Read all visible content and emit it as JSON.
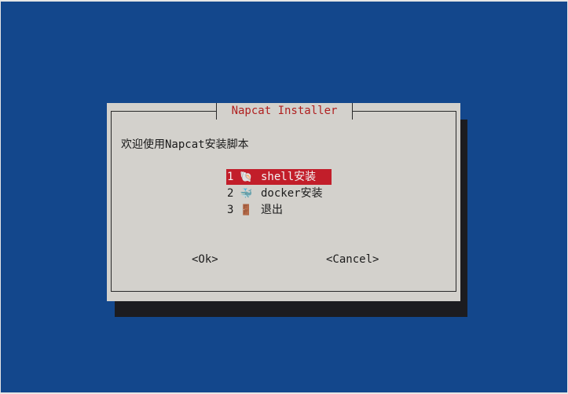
{
  "dialog": {
    "title": "Napcat Installer",
    "prompt": "欢迎使用Napcat安装脚本",
    "menu": [
      {
        "num": "1",
        "icon": "🐚",
        "icon_name": "shell-icon",
        "label": "shell安装",
        "selected": true
      },
      {
        "num": "2",
        "icon": "🐳",
        "icon_name": "whale-icon",
        "label": "docker安装",
        "selected": false
      },
      {
        "num": "3",
        "icon": "🚪",
        "icon_name": "door-icon",
        "label": "退出",
        "selected": false
      }
    ],
    "ok_label": "<Ok>",
    "cancel_label": "<Cancel>"
  },
  "colors": {
    "background": "#13478c",
    "dialog": "#d3d1cc",
    "selected": "#c21e2a",
    "title": "#b02020",
    "shadow": "#1c1c20"
  }
}
